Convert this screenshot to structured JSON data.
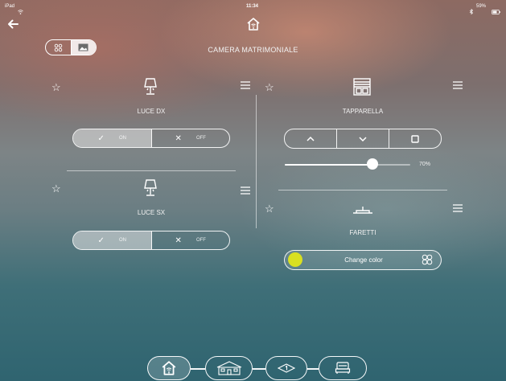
{
  "status_bar": {
    "device": "iPad",
    "time": "11:34",
    "battery": "59%"
  },
  "header": {
    "room_title": "CAMERA MATRIMONIALE"
  },
  "view_toggle": {
    "grid_icon": "grid-icon",
    "image_icon": "image-icon"
  },
  "devices": {
    "luce_dx": {
      "label": "LUCE DX",
      "on_label": "ON",
      "off_label": "OFF",
      "state": "on"
    },
    "luce_sx": {
      "label": "LUCE SX",
      "on_label": "ON",
      "off_label": "OFF",
      "state": "on"
    },
    "tapparella": {
      "label": "TAPPARELLA",
      "level_text": "70%",
      "level": 0.7
    },
    "faretti": {
      "label": "FARETTI",
      "color_button": "Change color",
      "color": "#d9e021"
    }
  },
  "bottom_nav": {
    "items": [
      "home-icon",
      "building-icon",
      "floor-icon",
      "room-icon"
    ]
  }
}
